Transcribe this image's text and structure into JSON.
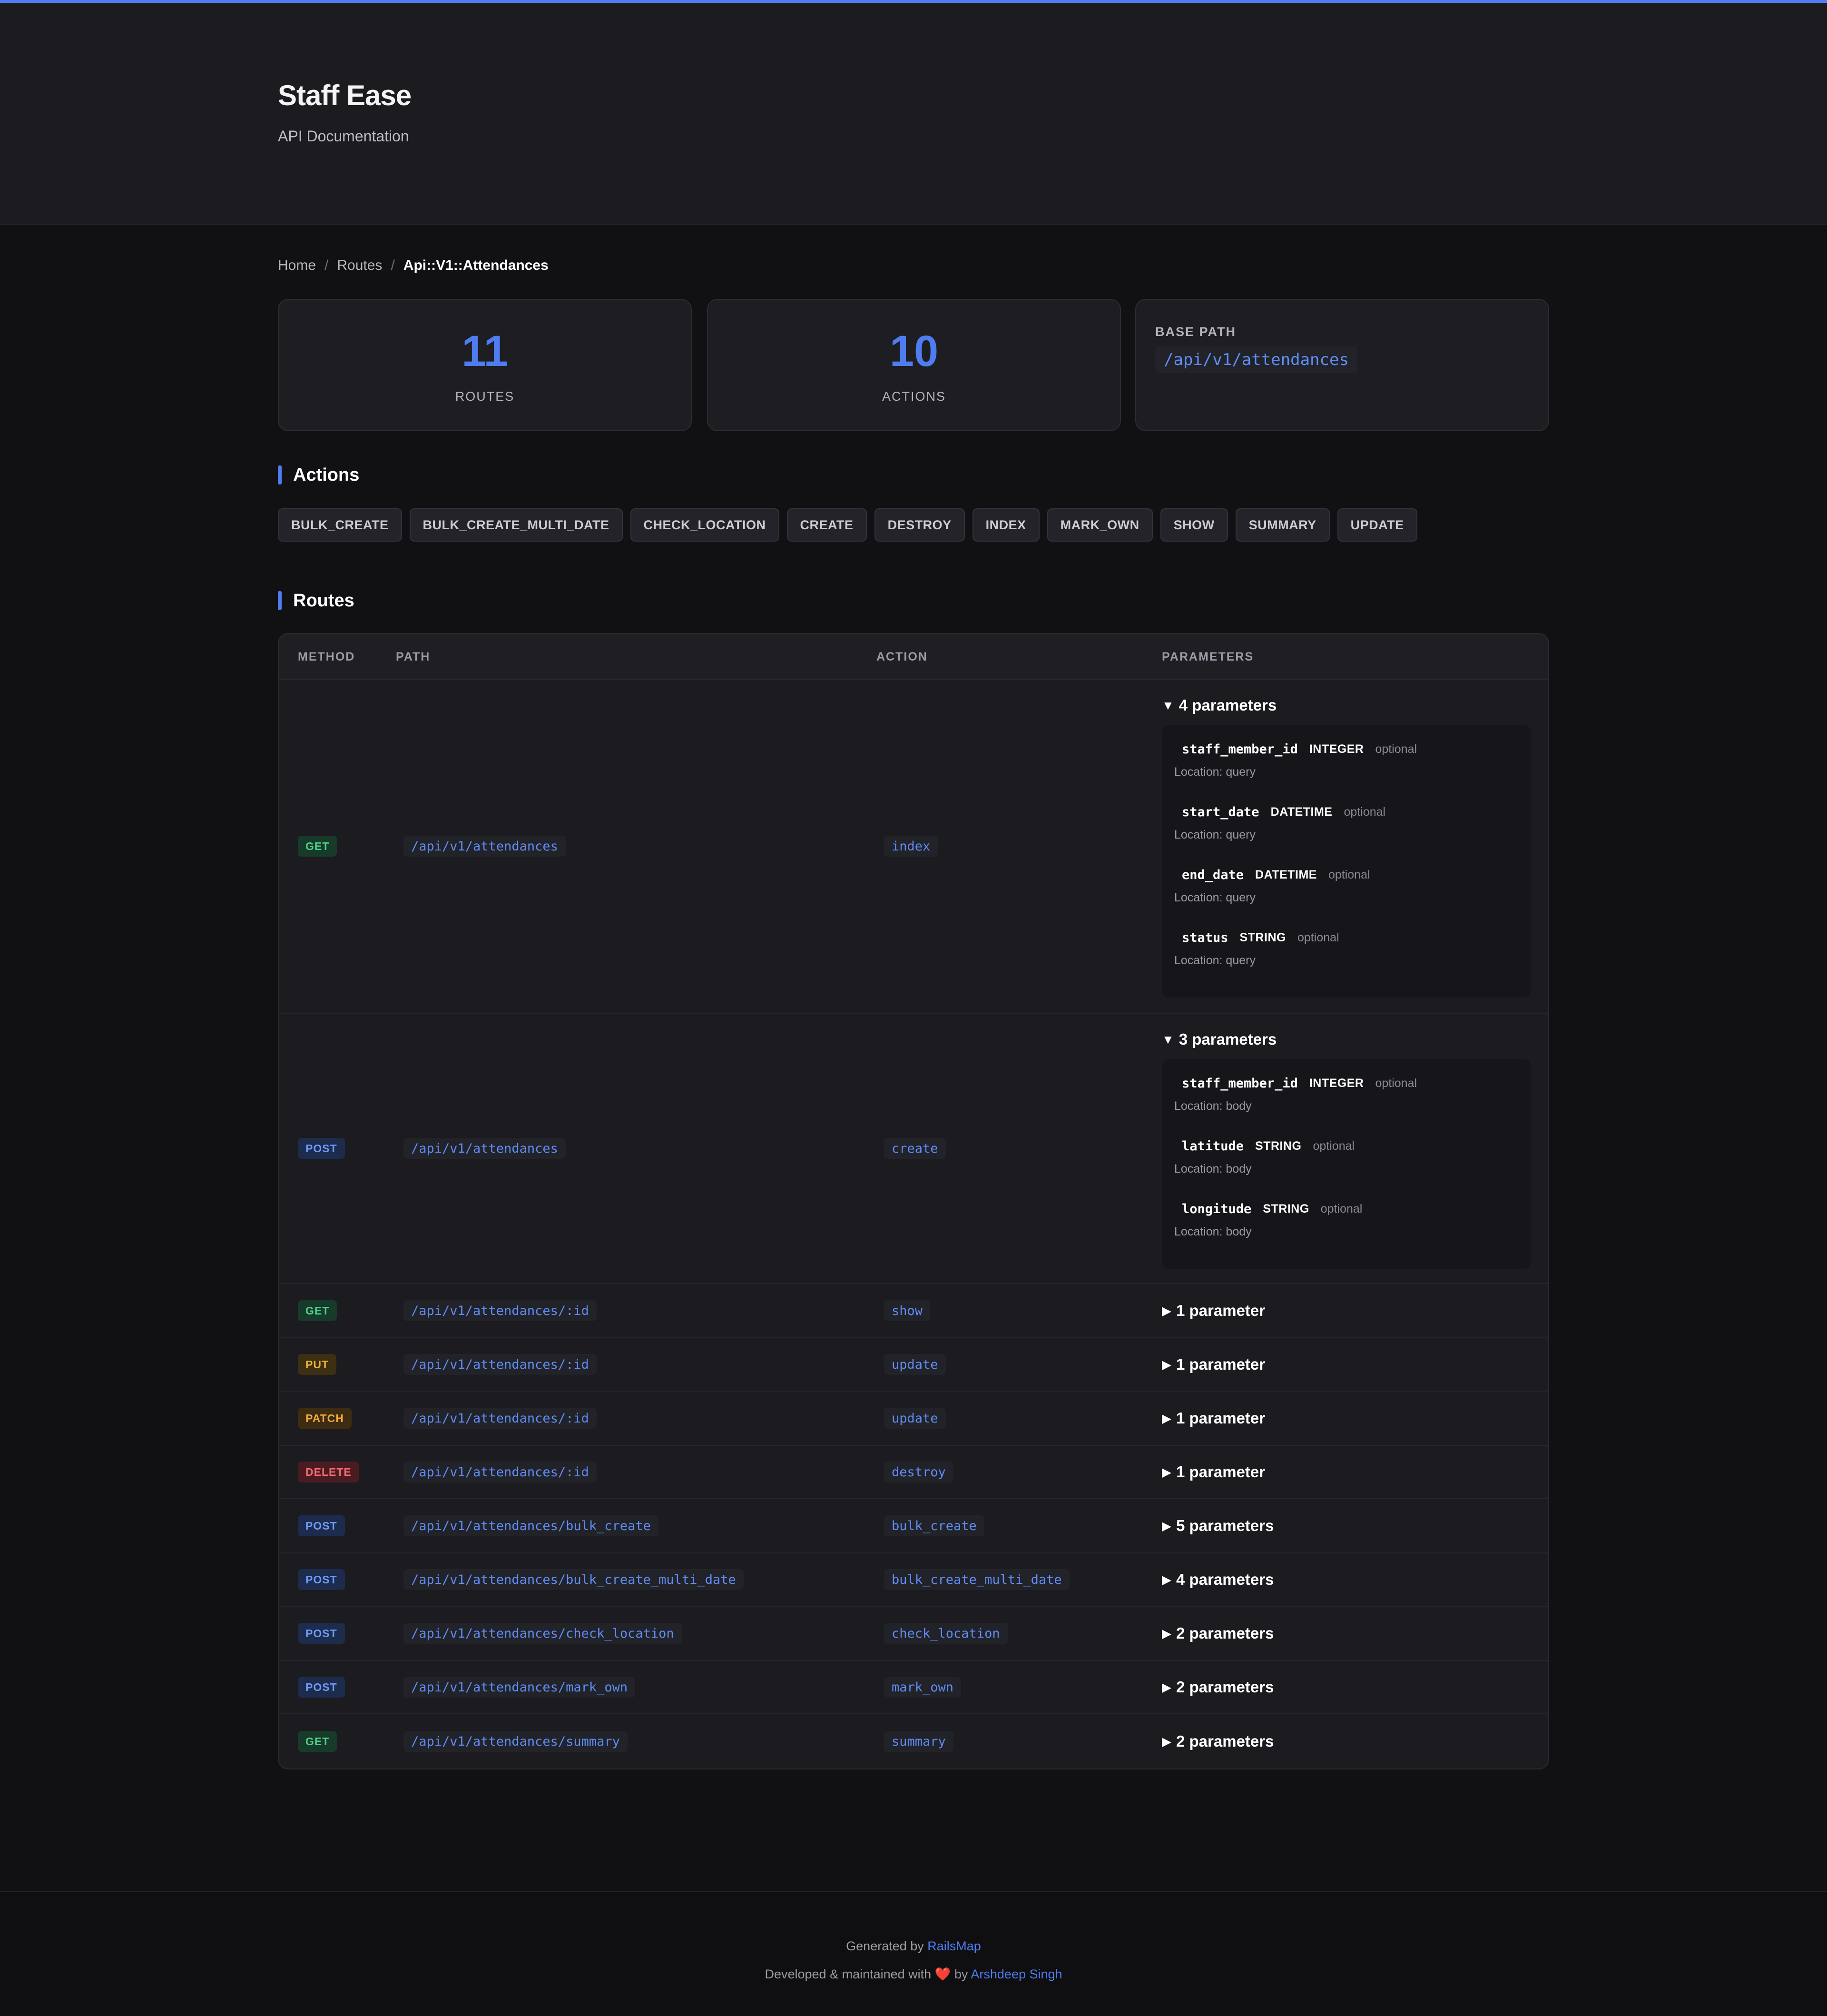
{
  "header": {
    "title": "Staff Ease",
    "subtitle": "API Documentation"
  },
  "breadcrumb": {
    "home": "Home",
    "routes": "Routes",
    "current": "Api::V1::Attendances",
    "separator": "/"
  },
  "stats": {
    "routes": {
      "value": "11",
      "label": "ROUTES"
    },
    "actions": {
      "value": "10",
      "label": "ACTIONS"
    },
    "base_path": {
      "label": "BASE PATH",
      "value": "/api/v1/attendances"
    }
  },
  "actions_section": {
    "title": "Actions",
    "items": [
      "BULK_CREATE",
      "BULK_CREATE_MULTI_DATE",
      "CHECK_LOCATION",
      "CREATE",
      "DESTROY",
      "INDEX",
      "MARK_OWN",
      "SHOW",
      "SUMMARY",
      "UPDATE"
    ]
  },
  "routes_section": {
    "title": "Routes",
    "columns": {
      "method": "METHOD",
      "path": "PATH",
      "action": "ACTION",
      "parameters": "PARAMETERS"
    },
    "rows": [
      {
        "method": "GET",
        "path": "/api/v1/attendances",
        "action": "index",
        "params_label": "4 parameters",
        "expanded": true,
        "toggle": "▼",
        "params": [
          {
            "name": "staff_member_id",
            "type": "INTEGER",
            "required": "optional",
            "location": "Location: query"
          },
          {
            "name": "start_date",
            "type": "DATETIME",
            "required": "optional",
            "location": "Location: query"
          },
          {
            "name": "end_date",
            "type": "DATETIME",
            "required": "optional",
            "location": "Location: query"
          },
          {
            "name": "status",
            "type": "STRING",
            "required": "optional",
            "location": "Location: query"
          }
        ]
      },
      {
        "method": "POST",
        "path": "/api/v1/attendances",
        "action": "create",
        "params_label": "3 parameters",
        "expanded": true,
        "toggle": "▼",
        "params": [
          {
            "name": "staff_member_id",
            "type": "INTEGER",
            "required": "optional",
            "location": "Location: body"
          },
          {
            "name": "latitude",
            "type": "STRING",
            "required": "optional",
            "location": "Location: body"
          },
          {
            "name": "longitude",
            "type": "STRING",
            "required": "optional",
            "location": "Location: body"
          }
        ]
      },
      {
        "method": "GET",
        "path": "/api/v1/attendances/:id",
        "action": "show",
        "params_label": "1 parameter",
        "toggle": "▶"
      },
      {
        "method": "PUT",
        "path": "/api/v1/attendances/:id",
        "action": "update",
        "params_label": "1 parameter",
        "toggle": "▶"
      },
      {
        "method": "PATCH",
        "path": "/api/v1/attendances/:id",
        "action": "update",
        "params_label": "1 parameter",
        "toggle": "▶"
      },
      {
        "method": "DELETE",
        "path": "/api/v1/attendances/:id",
        "action": "destroy",
        "params_label": "1 parameter",
        "toggle": "▶"
      },
      {
        "method": "POST",
        "path": "/api/v1/attendances/bulk_create",
        "action": "bulk_create",
        "params_label": "5 parameters",
        "toggle": "▶"
      },
      {
        "method": "POST",
        "path": "/api/v1/attendances/bulk_create_multi_date",
        "action": "bulk_create_multi_date",
        "params_label": "4 parameters",
        "toggle": "▶"
      },
      {
        "method": "POST",
        "path": "/api/v1/attendances/check_location",
        "action": "check_location",
        "params_label": "2 parameters",
        "toggle": "▶"
      },
      {
        "method": "POST",
        "path": "/api/v1/attendances/mark_own",
        "action": "mark_own",
        "params_label": "2 parameters",
        "toggle": "▶"
      },
      {
        "method": "GET",
        "path": "/api/v1/attendances/summary",
        "action": "summary",
        "params_label": "2 parameters",
        "toggle": "▶"
      }
    ]
  },
  "footer": {
    "generated_prefix": "Generated by",
    "generated_link": "RailsMap",
    "developed_prefix": "Developed & maintained with",
    "heart": "❤️",
    "by": "by",
    "author_link": "Arshdeep Singh"
  },
  "colors": {
    "accent": "#4f7cf0",
    "background": "#111113",
    "panel": "#1b1b20"
  }
}
